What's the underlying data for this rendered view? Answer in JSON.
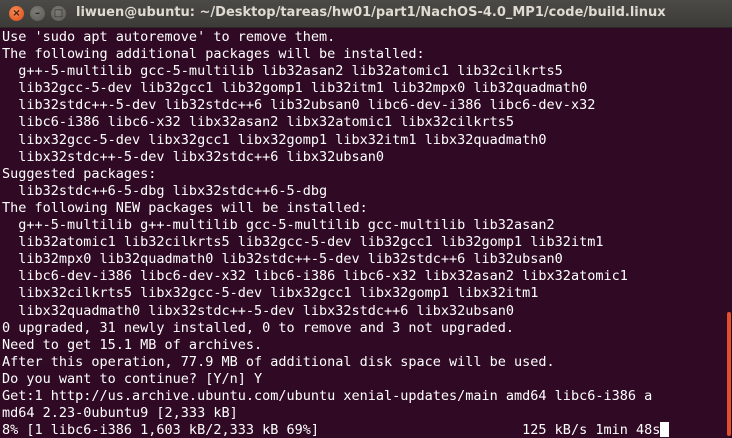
{
  "window": {
    "title": "liwuen@ubuntu: ~/Desktop/tareas/hw01/part1/NachOS-4.0_MP1/code/build.linux",
    "close_glyph": "×",
    "minimize_glyph": "–",
    "maximize_glyph": "□"
  },
  "terminal": {
    "lines": [
      "Use 'sudo apt autoremove' to remove them.",
      "The following additional packages will be installed:",
      "  g++-5-multilib gcc-5-multilib lib32asan2 lib32atomic1 lib32cilkrts5",
      "  lib32gcc-5-dev lib32gcc1 lib32gomp1 lib32itm1 lib32mpx0 lib32quadmath0",
      "  lib32stdc++-5-dev lib32stdc++6 lib32ubsan0 libc6-dev-i386 libc6-dev-x32",
      "  libc6-i386 libc6-x32 libx32asan2 libx32atomic1 libx32cilkrts5",
      "  libx32gcc-5-dev libx32gcc1 libx32gomp1 libx32itm1 libx32quadmath0",
      "  libx32stdc++-5-dev libx32stdc++6 libx32ubsan0",
      "Suggested packages:",
      "  lib32stdc++6-5-dbg libx32stdc++6-5-dbg",
      "The following NEW packages will be installed:",
      "  g++-5-multilib g++-multilib gcc-5-multilib gcc-multilib lib32asan2",
      "  lib32atomic1 lib32cilkrts5 lib32gcc-5-dev lib32gcc1 lib32gomp1 lib32itm1",
      "  lib32mpx0 lib32quadmath0 lib32stdc++-5-dev lib32stdc++6 lib32ubsan0",
      "  libc6-dev-i386 libc6-dev-x32 libc6-i386 libc6-x32 libx32asan2 libx32atomic1",
      "  libx32cilkrts5 libx32gcc-5-dev libx32gcc1 libx32gomp1 libx32itm1",
      "  libx32quadmath0 libx32stdc++-5-dev libx32stdc++6 libx32ubsan0",
      "0 upgraded, 31 newly installed, 0 to remove and 3 not upgraded.",
      "Need to get 15.1 MB of archives.",
      "After this operation, 77.9 MB of additional disk space will be used.",
      "Do you want to continue? [Y/n] Y",
      "Get:1 http://us.archive.ubuntu.com/ubuntu xenial-updates/main amd64 libc6-i386 a",
      "md64 2.23-0ubuntu9 [2,333 kB]",
      "8% [1 libc6-i386 1,603 kB/2,333 kB 69%]                         125 kB/s 1min 48s"
    ]
  },
  "colors": {
    "terminal_background": "#300a24",
    "text": "#ffffff",
    "scrollbar": "#e0502a"
  }
}
